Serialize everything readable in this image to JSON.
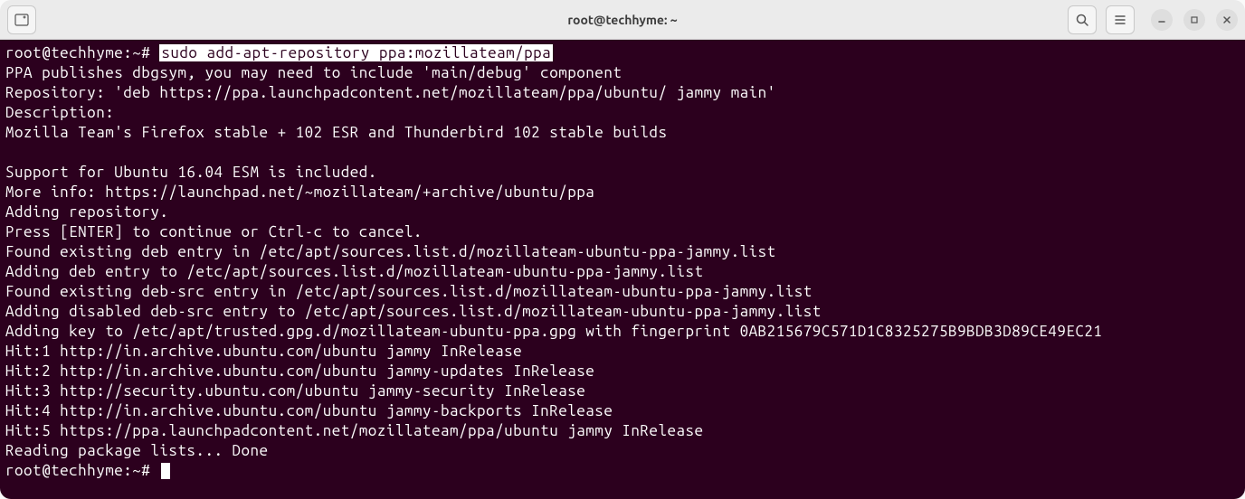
{
  "titlebar": {
    "title": "root@techhyme: ~"
  },
  "terminal": {
    "prompt1": "root@techhyme:~# ",
    "command": "sudo add-apt-repository ppa:mozillateam/ppa",
    "output": [
      "PPA publishes dbgsym, you may need to include 'main/debug' component",
      "Repository: 'deb https://ppa.launchpadcontent.net/mozillateam/ppa/ubuntu/ jammy main'",
      "Description:",
      "Mozilla Team's Firefox stable + 102 ESR and Thunderbird 102 stable builds",
      "",
      "Support for Ubuntu 16.04 ESM is included.",
      "More info: https://launchpad.net/~mozillateam/+archive/ubuntu/ppa",
      "Adding repository.",
      "Press [ENTER] to continue or Ctrl-c to cancel.",
      "Found existing deb entry in /etc/apt/sources.list.d/mozillateam-ubuntu-ppa-jammy.list",
      "Adding deb entry to /etc/apt/sources.list.d/mozillateam-ubuntu-ppa-jammy.list",
      "Found existing deb-src entry in /etc/apt/sources.list.d/mozillateam-ubuntu-ppa-jammy.list",
      "Adding disabled deb-src entry to /etc/apt/sources.list.d/mozillateam-ubuntu-ppa-jammy.list",
      "Adding key to /etc/apt/trusted.gpg.d/mozillateam-ubuntu-ppa.gpg with fingerprint 0AB215679C571D1C8325275B9BDB3D89CE49EC21",
      "Hit:1 http://in.archive.ubuntu.com/ubuntu jammy InRelease",
      "Hit:2 http://in.archive.ubuntu.com/ubuntu jammy-updates InRelease",
      "Hit:3 http://security.ubuntu.com/ubuntu jammy-security InRelease",
      "Hit:4 http://in.archive.ubuntu.com/ubuntu jammy-backports InRelease",
      "Hit:5 https://ppa.launchpadcontent.net/mozillateam/ppa/ubuntu jammy InRelease",
      "Reading package lists... Done"
    ],
    "prompt2": "root@techhyme:~# "
  }
}
